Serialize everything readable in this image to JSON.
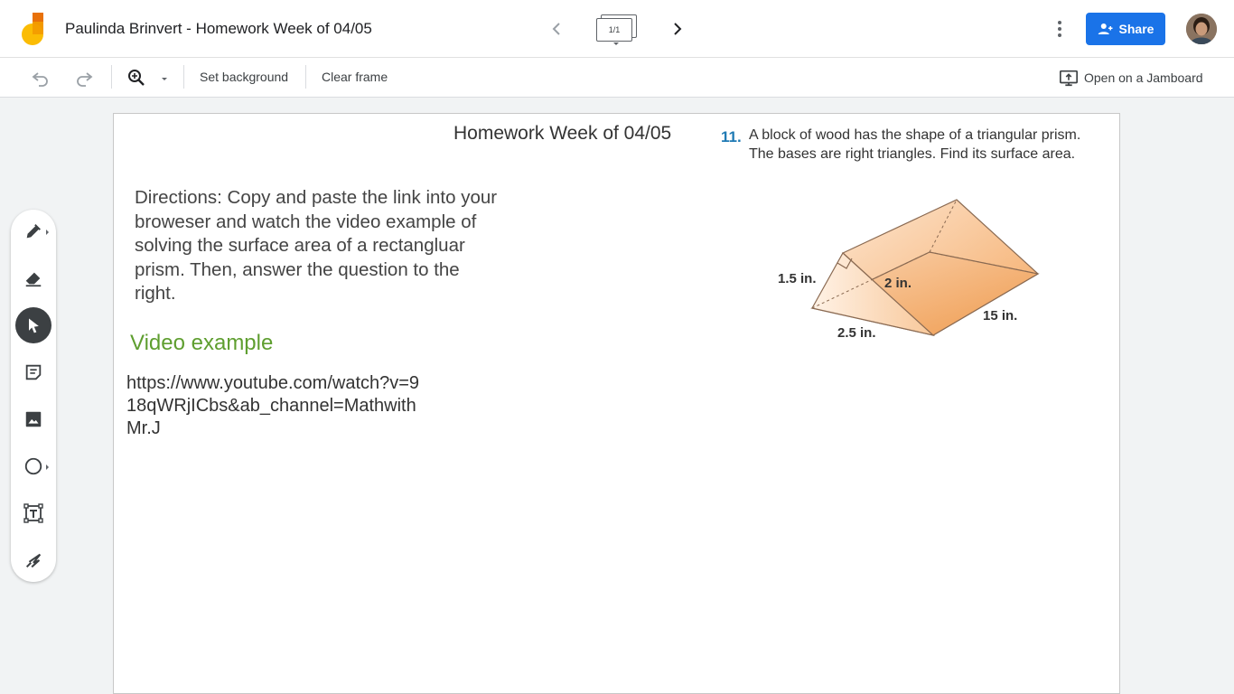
{
  "header": {
    "doc_title": "Paulinda Brinvert - Homework Week of 04/05",
    "frame_counter": "1/1",
    "share_label": "Share"
  },
  "toolbar": {
    "set_background": "Set background",
    "clear_frame": "Clear frame",
    "open_on_jamboard": "Open on a Jamboard"
  },
  "tools": [
    "pen-tool",
    "eraser-tool",
    "select-tool",
    "sticky-note-tool",
    "image-tool",
    "shape-tool",
    "text-box-tool",
    "laser-tool"
  ],
  "active_tool": "select-tool",
  "frame": {
    "title": "Homework Week of 04/05",
    "directions": "Directions: Copy and paste the link into your broweser and watch the video example of solving the surface area of a rectangluar prism. Then, answer the question to the right.",
    "video_heading": "Video example",
    "video_link": "https://www.youtube.com/watch?v=918qWRjICbs&ab_channel=MathwithMr.J",
    "problem": {
      "number": "11.",
      "text": "A block of wood has the shape of a triangular prism. The bases are right triangles. Find its surface area.",
      "labels": {
        "height": "1.5 in.",
        "hypotenuse": "2 in.",
        "base": "2.5 in.",
        "length": "15 in."
      }
    }
  },
  "colors": {
    "share_blue": "#1a73e8",
    "video_heading_green": "#5e9e2f",
    "problem_number_blue": "#1f7ab4",
    "prism_orange": "#f2a463"
  }
}
